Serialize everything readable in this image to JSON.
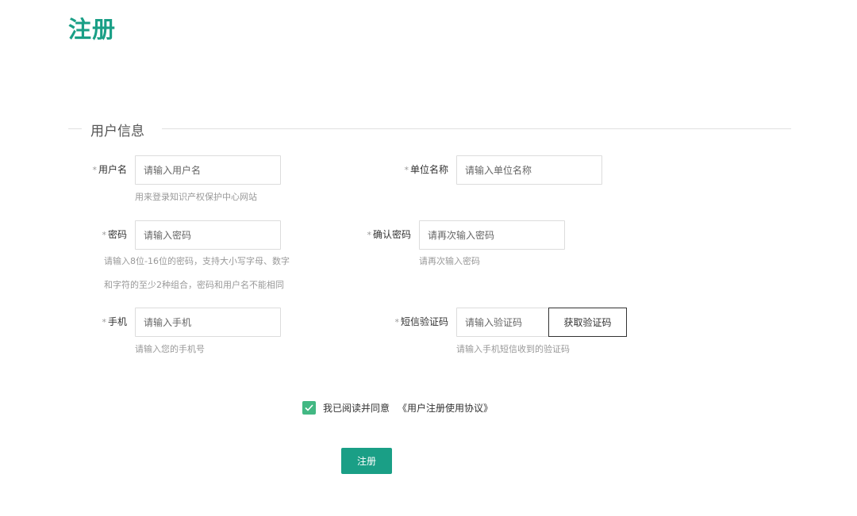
{
  "page": {
    "title": "注册"
  },
  "section": {
    "legend": "用户信息"
  },
  "form": {
    "username": {
      "required_mark": "*",
      "label": "用户名",
      "placeholder": "请输入用户名",
      "hint": "用来登录知识产权保护中心网站"
    },
    "org_name": {
      "required_mark": "*",
      "label": "单位名称",
      "placeholder": "请输入单位名称"
    },
    "password": {
      "required_mark": "*",
      "label": "密码",
      "placeholder": "请输入密码",
      "hint_line1": "请输入8位-16位的密码，支持大小写字母、数字",
      "hint_line2": "和字符的至少2种组合，密码和用户名不能相同"
    },
    "confirm_password": {
      "required_mark": "*",
      "label": "确认密码",
      "placeholder": "请再次输入密码",
      "hint": "请再次输入密码"
    },
    "phone": {
      "required_mark": "*",
      "label": "手机",
      "placeholder": "请输入手机",
      "hint": "请输入您的手机号"
    },
    "sms_code": {
      "required_mark": "*",
      "label": "短信验证码",
      "placeholder": "请输入验证码",
      "button_label": "获取验证码",
      "hint": "请输入手机短信收到的验证码"
    }
  },
  "agreement": {
    "checked": true,
    "text": "我已阅读并同意",
    "link_text": "《用户注册使用协议》"
  },
  "submit": {
    "label": "注册"
  },
  "colors": {
    "accent": "#1a9f86",
    "checkbox": "#42b883"
  }
}
